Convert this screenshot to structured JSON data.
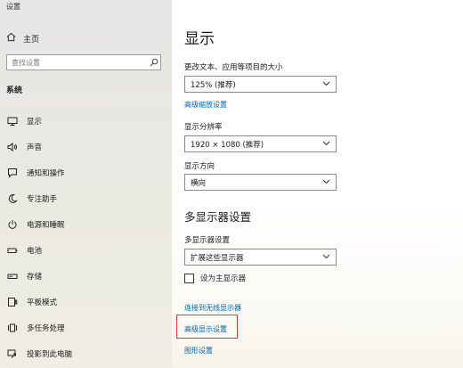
{
  "window": {
    "title": "设置"
  },
  "sidebar": {
    "home_label": "主页",
    "search_placeholder": "查找设置",
    "section_title": "系统",
    "items": [
      {
        "label": "显示",
        "icon": "monitor-icon"
      },
      {
        "label": "声音",
        "icon": "speaker-icon"
      },
      {
        "label": "通知和操作",
        "icon": "notification-icon"
      },
      {
        "label": "专注助手",
        "icon": "moon-icon"
      },
      {
        "label": "电源和睡眠",
        "icon": "power-icon"
      },
      {
        "label": "电池",
        "icon": "battery-icon"
      },
      {
        "label": "存储",
        "icon": "storage-icon"
      },
      {
        "label": "平板模式",
        "icon": "tablet-icon"
      },
      {
        "label": "多任务处理",
        "icon": "multitask-icon"
      },
      {
        "label": "投影到此电脑",
        "icon": "project-icon"
      }
    ]
  },
  "main": {
    "title": "显示",
    "scale_label": "更改文本、应用等项目的大小",
    "scale_value": "125% (推荐)",
    "advanced_scaling_link": "高级缩放设置",
    "resolution_label": "显示分辨率",
    "resolution_value": "1920 × 1080 (推荐)",
    "orientation_label": "显示方向",
    "orientation_value": "横向",
    "multi_display_title": "多显示器设置",
    "multi_display_label": "多显示器设置",
    "multi_display_value": "扩展这些显示器",
    "main_display_checkbox": "设为主显示器",
    "wireless_link": "连接到无线显示器",
    "advanced_display_link": "高级显示设置",
    "graphics_link": "图形设置"
  },
  "colors": {
    "link": "#0063b1",
    "highlight_border": "#e23a3a"
  }
}
